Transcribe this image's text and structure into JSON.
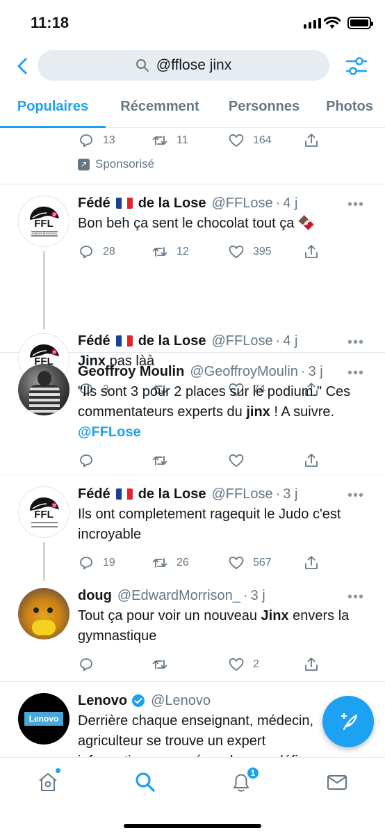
{
  "status_bar": {
    "time": "11:18"
  },
  "search": {
    "query": "@fflose jinx"
  },
  "tabs": [
    {
      "label": "Populaires",
      "active": true
    },
    {
      "label": "Récemment",
      "active": false
    },
    {
      "label": "Personnes",
      "active": false
    },
    {
      "label": "Photos",
      "active": false
    }
  ],
  "sponsored_tweet": {
    "replies": "13",
    "retweets": "11",
    "likes": "164",
    "sponsored_label": "Sponsorisé"
  },
  "tweets": [
    {
      "name_part1": "Fédé",
      "name_part2": "de la Lose",
      "handle": "@FFLose",
      "time": "4 j",
      "text": "Bon beh ça sent le chocolat tout ça 🍫",
      "replies": "28",
      "retweets": "12",
      "likes": "395"
    },
    {
      "name_part1": "Fédé",
      "name_part2": "de la Lose",
      "handle": "@FFLose",
      "time": "4 j",
      "text_bold": "Jinx",
      "text_rest": " pas làà",
      "replies": "3",
      "retweets": "",
      "likes": "74"
    },
    {
      "name": "Geoffroy Moulin",
      "handle": "@GeoffroyMoulin",
      "time": "3 j",
      "text_a": "\"Ils sont 3 pour 2 places sur le podium.\" Ces commentateurs experts du ",
      "text_bold": "jinx",
      "text_b": " ! A suivre. ",
      "mention": "@FFLose",
      "replies": "",
      "retweets": "",
      "likes": ""
    },
    {
      "name_part1": "Fédé",
      "name_part2": "de la Lose",
      "handle": "@FFLose",
      "time": "3 j",
      "text": "Ils ont completement ragequit le Judo c'est incroyable",
      "replies": "19",
      "retweets": "26",
      "likes": "567"
    },
    {
      "name": "doug",
      "handle": "@EdwardMorrison_",
      "time": "3 j",
      "text_a": "Tout ça pour voir un nouveau ",
      "text_bold": "Jinx",
      "text_b": " envers la gymnastique",
      "replies": "",
      "retweets": "",
      "likes": "2"
    },
    {
      "name": "Lenovo",
      "handle": "@Lenovo",
      "text": "Derrière chaque enseignant, médecin, agriculteur se trouve un expert informatique pour répondre aux défis",
      "avatar_text": "Lenovo"
    }
  ],
  "ffl_logo": {
    "letters": "FFL",
    "tagline": "LA DÉFAITE EST EN NOUS"
  },
  "bottom_nav": {
    "notifications_badge": "1"
  },
  "colors": {
    "accent": "#1da1f2",
    "secondary_text": "#657786",
    "divider": "#e1e8ed"
  }
}
